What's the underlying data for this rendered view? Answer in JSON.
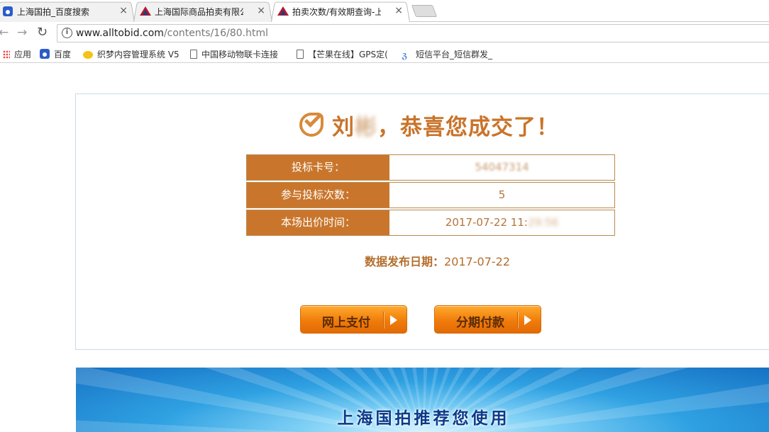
{
  "browser": {
    "tabs": [
      {
        "label": "上海国拍_百度搜索",
        "icon": "baidu-paw-icon",
        "active": false
      },
      {
        "label": "上海国际商品拍卖有限公",
        "icon": "alltobid-logo-icon",
        "active": false
      },
      {
        "label": "拍卖次数/有效期查询-上",
        "icon": "alltobid-logo-icon",
        "active": true
      }
    ],
    "close_glyph": "×",
    "url": {
      "host": "www.alltobid.com",
      "path": "/contents/16/80.html"
    },
    "bookmarks": [
      {
        "label": "应用",
        "icon": "apps-grid-icon"
      },
      {
        "label": "百度",
        "icon": "baidu-paw-icon"
      },
      {
        "label": "织梦内容管理系统 V5",
        "icon": "dedecms-icon"
      },
      {
        "label": "中国移动物联卡连接",
        "icon": "page-icon"
      },
      {
        "label": "【芒果在线】GPS定(",
        "icon": "page-icon"
      },
      {
        "label": "短信平台_短信群发_",
        "icon": "sms-logo-icon"
      }
    ]
  },
  "result": {
    "name_visible": "刘",
    "name_blurred": "彬",
    "congrats": "，恭喜您成交了！",
    "rows": [
      {
        "label": "投标卡号：",
        "value": "54047314",
        "blurred": true
      },
      {
        "label": "参与投标次数：",
        "value": "5",
        "blurred": false
      },
      {
        "label": "本场出价时间：",
        "value": "2017-07-22 11:",
        "value_blurred": "29:56",
        "blurred": false
      }
    ],
    "publish_label": "数据发布日期：",
    "publish_date": "2017-07-22"
  },
  "buttons": {
    "pay_online": "网上支付",
    "installment": "分期付款"
  },
  "banner": {
    "text": "上海国拍推荐您使用"
  },
  "colors": {
    "accent": "#c9762c",
    "button_orange": "#f07c0b",
    "banner_blue": "#2fa1e2"
  }
}
